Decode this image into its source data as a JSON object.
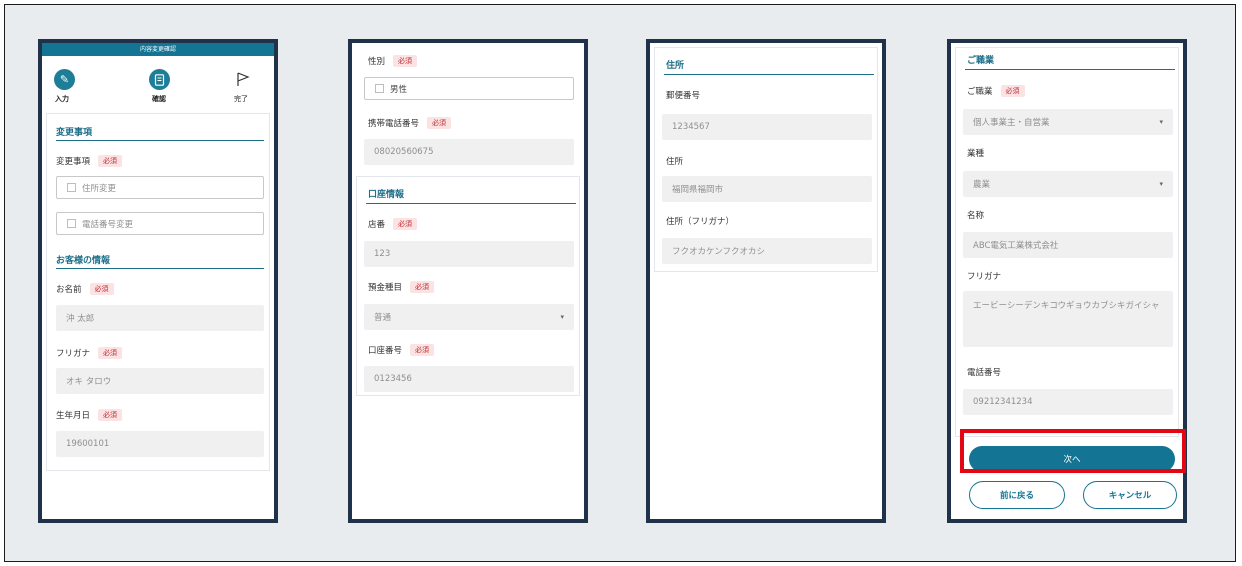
{
  "screen1": {
    "header_title": "内容変更確認",
    "steps": [
      {
        "label": "入力"
      },
      {
        "label": "確認"
      },
      {
        "label": "完了"
      }
    ],
    "change_section": {
      "title": "変更事項",
      "label": "変更事項",
      "required": "必須",
      "options": [
        "住所変更",
        "電話番号変更"
      ]
    },
    "customer_section": {
      "title": "お客様の情報",
      "name_label": "お名前",
      "name_value": "沖 太郎",
      "kana_label": "フリガナ",
      "kana_value": "オキ タロウ",
      "birth_label": "生年月日",
      "birth_value": "19600101",
      "required": "必須"
    }
  },
  "screen2": {
    "gender_label": "性別",
    "gender_value": "男性",
    "mobile_label": "携帯電話番号",
    "mobile_value": "08020560675",
    "bank_section_title": "口座情報",
    "branch_label": "店番",
    "branch_value": "123",
    "deposit_type_label": "預金種目",
    "deposit_type_value": "普通",
    "account_label": "口座番号",
    "account_value": "0123456",
    "required": "必須"
  },
  "screen3": {
    "address_section_title": "住所",
    "postal_label": "郵便番号",
    "postal_value": "1234567",
    "address_label": "住所",
    "address_value": "福岡県福岡市",
    "address_kana_label": "住所（フリガナ）",
    "address_kana_value": "フクオカケンフクオカシ"
  },
  "screen4": {
    "occupation_section_title": "ご職業",
    "occupation_label": "ご職業",
    "occupation_value": "個人事業主・自営業",
    "industry_label": "業種",
    "industry_value": "農業",
    "company_label": "名称",
    "company_value": "ABC電気工業株式会社",
    "company_kana_label": "フリガナ",
    "company_kana_value": "エービーシーデンキコウギョウカブシキガイシャ",
    "phone_label": "電話番号",
    "phone_value": "09212341234",
    "next_button": "次へ",
    "back_button": "前に戻る",
    "cancel_button": "キャンセル",
    "required": "必須"
  },
  "colors": {
    "accent": "#137493",
    "phone_frame": "#1f3249",
    "highlight": "#e30613",
    "required_text": "#c0282d",
    "required_bg": "#fbe3e4"
  }
}
